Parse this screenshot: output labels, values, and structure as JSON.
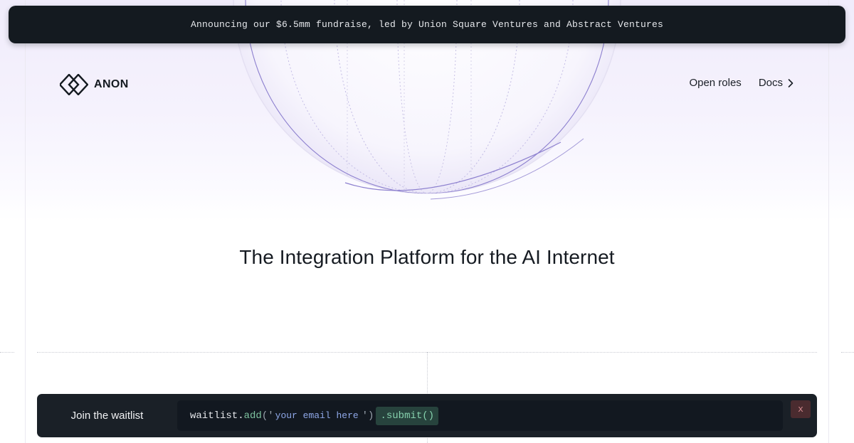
{
  "announcement": {
    "text": "Announcing our $6.5mm fundraise, led by Union Square Ventures and Abstract Ventures"
  },
  "brand": {
    "name": "ANON",
    "logo_icon": "interlocking-diamonds-icon"
  },
  "nav": {
    "open_roles": "Open roles",
    "docs": "Docs",
    "docs_icon": "chevron-right-icon"
  },
  "hero": {
    "headline": "The Integration Platform for the AI Internet"
  },
  "waitlist": {
    "label": "Join the waitlist",
    "code_object": "waitlist.",
    "code_method": "add",
    "code_open": "('",
    "input_placeholder": "your email here",
    "code_close": "')",
    "submit_label": ".submit()",
    "close_label": "x"
  },
  "colors": {
    "banner_bg": "#141a20",
    "waitlist_bg": "#1a2027",
    "accent_green": "#86d1ad",
    "accent_blue": "#8fa8e8",
    "close_red": "#d58a8f",
    "globe_stroke": "#9d90d6"
  }
}
